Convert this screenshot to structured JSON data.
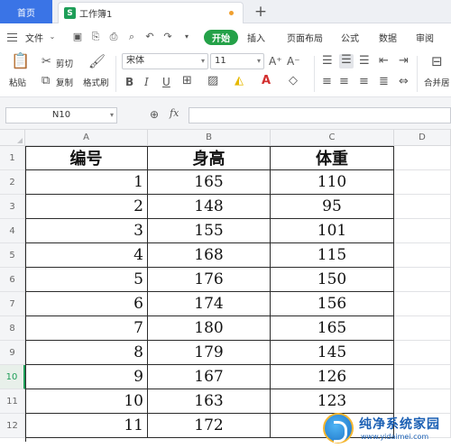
{
  "tabs": {
    "home": "首页",
    "doc_icon": "S",
    "doc_title": "工作簿1",
    "add": "+"
  },
  "menu": {
    "file": "文件",
    "start": "开始",
    "insert": "插入",
    "page_layout": "页面布局",
    "formula": "公式",
    "data": "数据",
    "review": "审阅"
  },
  "ribbon": {
    "paste": "粘贴",
    "cut": "剪切",
    "copy": "复制",
    "format_painter": "格式刷",
    "font_name": "宋体",
    "font_size": "11",
    "bold": "B",
    "italic": "I",
    "underline": "U",
    "merge_center": "合并居"
  },
  "formula_bar": {
    "name_box": "N10",
    "fx": "fx"
  },
  "sheet": {
    "columns": [
      "A",
      "B",
      "C",
      "D"
    ],
    "rows": [
      "1",
      "2",
      "3",
      "4",
      "5",
      "6",
      "7",
      "8",
      "9",
      "10",
      "11",
      "12"
    ],
    "active_row": "10",
    "header": [
      "编号",
      "身高",
      "体重"
    ],
    "data": [
      [
        "1",
        "165",
        "110"
      ],
      [
        "2",
        "148",
        "95"
      ],
      [
        "3",
        "155",
        "101"
      ],
      [
        "4",
        "168",
        "115"
      ],
      [
        "5",
        "176",
        "150"
      ],
      [
        "6",
        "174",
        "156"
      ],
      [
        "7",
        "180",
        "165"
      ],
      [
        "8",
        "179",
        "145"
      ],
      [
        "9",
        "167",
        "126"
      ],
      [
        "10",
        "163",
        "123"
      ],
      [
        "11",
        "172",
        ""
      ]
    ]
  },
  "watermark": {
    "title": "纯净系统家园",
    "url": "www.yidaimei.com"
  },
  "colors": {
    "home_tab": "#3a74e6",
    "start_button": "#24a148",
    "active_row": "#1e9e58"
  }
}
